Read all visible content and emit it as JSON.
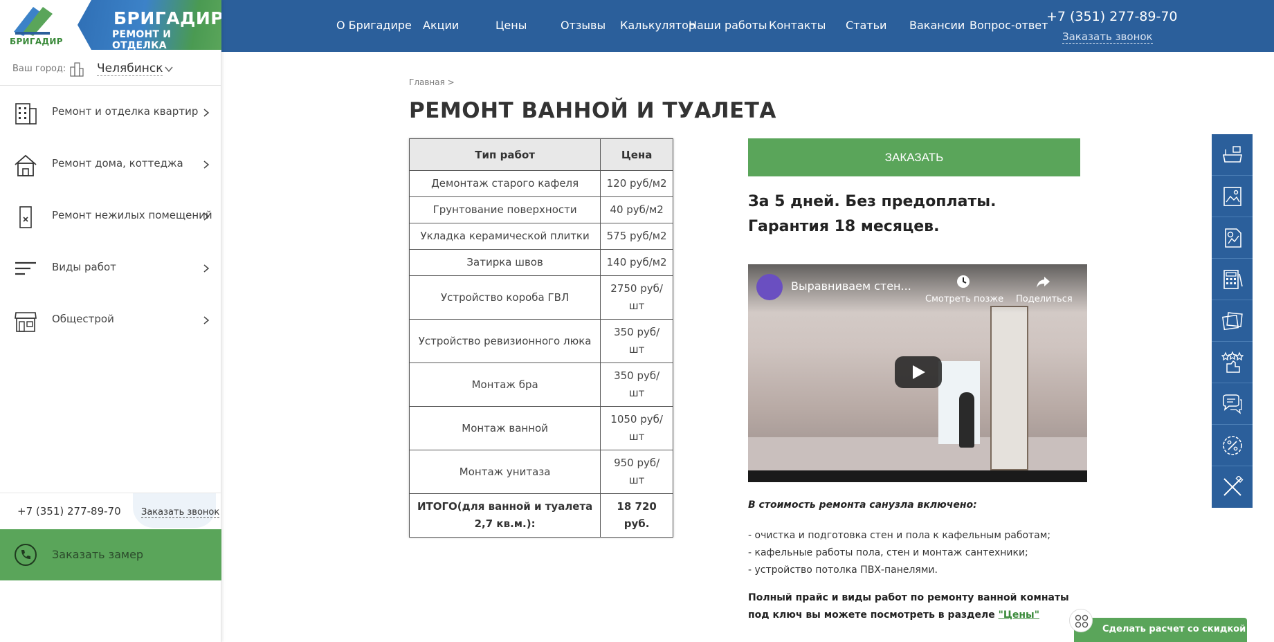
{
  "brand": {
    "logo_text": "БРИГАДИР",
    "title": "БРИГАДИР",
    "subtitle": "РЕМОНТ И ОТДЕЛКА",
    "green": "#5aa55a",
    "blue": "#2b5f9b"
  },
  "city": {
    "label": "Ваш город:",
    "name": "Челябинск"
  },
  "sidebar": {
    "items": [
      {
        "label": "Ремонт и отделка квартир",
        "icon": "apartment-building-icon"
      },
      {
        "label": "Ремонт дома, коттеджа",
        "icon": "house-icon"
      },
      {
        "label": "Ремонт нежилых помещений",
        "icon": "office-door-icon"
      },
      {
        "label": "Виды работ",
        "icon": "lines-list-icon"
      },
      {
        "label": "Общестрой",
        "icon": "storefront-icon"
      }
    ],
    "phone": "+7 (351) 277-89-70",
    "call_link": "Заказать звонок",
    "measure_button": "Заказать замер"
  },
  "nav": {
    "links": [
      "О Бригадире",
      "Акции",
      "Цены",
      "Отзывы",
      "Калькулятор",
      "Наши работы",
      "Контакты",
      "Статьи",
      "Вакансии",
      "Вопрос-ответ"
    ],
    "phone": "+7 (351) 277-89-70",
    "call_link": "Заказать звонок"
  },
  "page": {
    "breadcrumb": "Главная >",
    "title": "РЕМОНТ ВАННОЙ И ТУАЛЕТА"
  },
  "table": {
    "headers": [
      "Тип работ",
      "Цена"
    ],
    "rows": [
      [
        "Демонтаж старого кафеля",
        "120 руб/м2"
      ],
      [
        "Грунтование поверхности",
        "40 руб/м2"
      ],
      [
        "Укладка керамической плитки",
        "575 руб/м2"
      ],
      [
        "Затирка швов",
        "140 руб/м2"
      ],
      [
        "Устройство короба ГВЛ",
        "2750 руб/шт"
      ],
      [
        "Устройство ревизионного люка",
        "350 руб/шт"
      ],
      [
        "Монтаж бра",
        "350 руб/шт"
      ],
      [
        "Монтаж ванной",
        "1050 руб/шт"
      ],
      [
        "Монтаж унитаза",
        "950 руб/шт"
      ],
      [
        "ИТОГО(для ванной и туалета 2,7 кв.м.):",
        "18 720 руб."
      ]
    ]
  },
  "order": {
    "button": "ЗАКАЗАТЬ",
    "tagline": "За 5 дней. Без предоплаты. Гарантия 18 месяцев."
  },
  "video": {
    "title": "Выравниваем стен...",
    "watch_later": "Смотреть позже",
    "share": "Поделиться"
  },
  "included": {
    "title": "В стоимость ремонта санузла включено:",
    "items": [
      "- очистка и подготовка стен и пола к кафельным работам;",
      "- кафельные работы пола, стен и монтаж сантехники;",
      "- устройство потолка ПВХ-панелями."
    ],
    "full_price_text": "Полный прайс и виды работ по ремонту ванной комнаты под ключ вы можете посмотреть в разделе",
    "prices_link": "\"Цены\""
  },
  "rail": {
    "icons": [
      "bathroom-icon",
      "gallery-icon",
      "chart-document-icon",
      "calculator-icon",
      "photos-icon",
      "reviews-stars-icon",
      "chat-icon",
      "discount-percent-icon",
      "tools-icon"
    ]
  },
  "discount": {
    "label": "Сделать расчет со скидкой"
  }
}
